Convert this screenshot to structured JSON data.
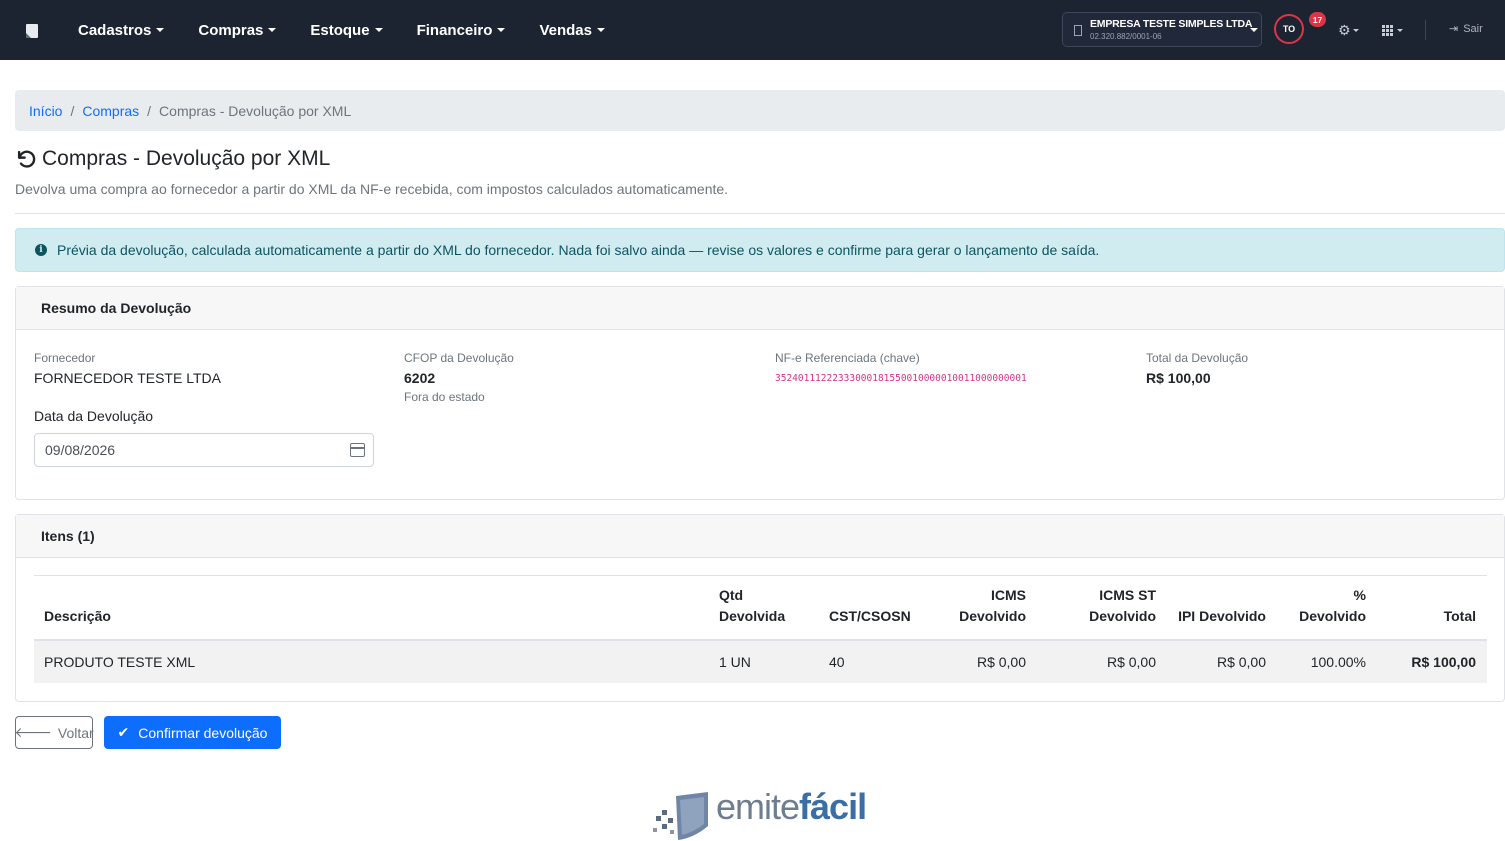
{
  "nav": {
    "items": [
      {
        "label": "Cadastros"
      },
      {
        "label": "Compras"
      },
      {
        "label": "Estoque"
      },
      {
        "label": "Financeiro"
      },
      {
        "label": "Vendas"
      }
    ],
    "company": {
      "name": "EMPRESA TESTE SIMPLES LTDA",
      "cnpj": "02.320.882/0001-06"
    },
    "user_initials": "TO",
    "notifications": "17",
    "logout_label": "Sair"
  },
  "breadcrumb": {
    "home": "Início",
    "section": "Compras",
    "current": "Compras - Devolução por XML"
  },
  "page": {
    "title": "Compras - Devolução por XML",
    "subtitle": "Devolva uma compra ao fornecedor a partir do XML da NF-e recebida, com impostos calculados automaticamente."
  },
  "alert": {
    "text": "Prévia da devolução, calculada automaticamente a partir do XML do fornecedor. Nada foi salvo ainda — revise os valores e confirme para gerar o lançamento de saída."
  },
  "summary": {
    "header": "Resumo da Devolução",
    "supplier_label": "Fornecedor",
    "supplier_value": "FORNECEDOR TESTE LTDA",
    "cfop_label": "CFOP da Devolução",
    "cfop_value": "6202",
    "cfop_note": "Fora do estado",
    "nfe_label": "NF-e Referenciada (chave)",
    "nfe_value": "35240111222333000181550010000010011000000001",
    "total_label": "Total da Devolução",
    "total_value": "R$ 100,00",
    "date_label": "Data da Devolução",
    "date_value": "09/08/2026"
  },
  "items": {
    "header": "Itens (1)",
    "columns": {
      "descricao": "Descrição",
      "qtd_1": "Qtd",
      "qtd_2": "Devolvida",
      "cst": "CST/CSOSN",
      "icms_1": "ICMS",
      "icms_2": "Devolvido",
      "icmsst_1": "ICMS ST",
      "icmsst_2": "Devolvido",
      "ipi": "IPI Devolvido",
      "pct_1": "%",
      "pct_2": "Devolvido",
      "total": "Total"
    },
    "rows": [
      {
        "descricao": "PRODUTO TESTE XML",
        "qtd": "1 UN",
        "cst": "40",
        "icms": "R$ 0,00",
        "icms_st": "R$ 0,00",
        "ipi": "R$ 0,00",
        "pct": "100.00%",
        "total": "R$ 100,00"
      }
    ]
  },
  "actions": {
    "back_label": "Voltar",
    "confirm_label": "Confirmar devolução"
  },
  "footer": {
    "logo_left": "emite",
    "logo_right": "fácil"
  }
}
